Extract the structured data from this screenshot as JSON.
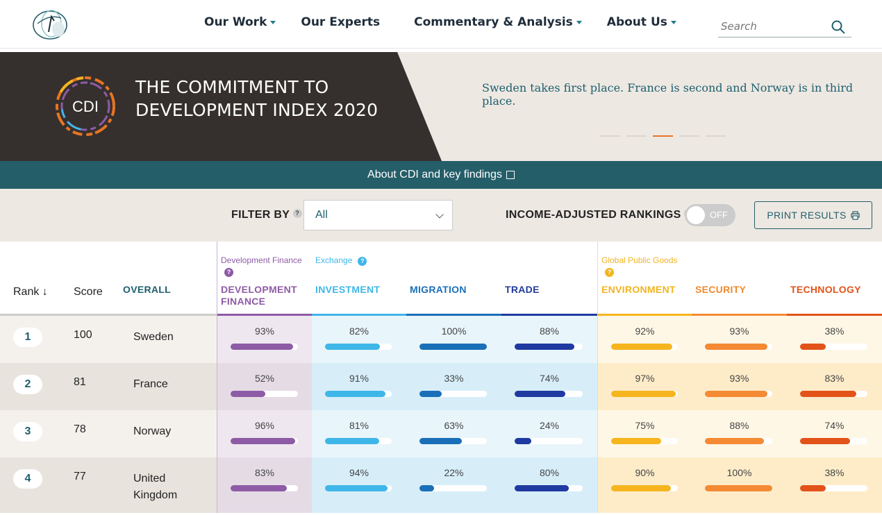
{
  "nav": {
    "items": [
      {
        "label": "Our Work",
        "dropdown": true
      },
      {
        "label": "Our Experts",
        "dropdown": false
      },
      {
        "label": "Commentary & Analysis",
        "dropdown": true
      },
      {
        "label": "About Us",
        "dropdown": true
      }
    ],
    "search_placeholder": "Search"
  },
  "banner": {
    "badge": "CDI",
    "title_line1": "THE COMMITMENT TO",
    "title_line2": "DEVELOPMENT INDEX 2020",
    "message": "Sweden takes first place. France is second and Norway is in third place.",
    "slide_count": 5,
    "active_slide": 3
  },
  "about_bar": {
    "label": "About CDI and key findings"
  },
  "filters": {
    "filter_label": "FILTER BY",
    "filter_value": "All",
    "income_label": "INCOME-ADJUSTED RANKINGS",
    "toggle_text": "OFF",
    "print_label": "PRINT RESULTS"
  },
  "table": {
    "rank_header": "Rank ↓",
    "score_header": "Score",
    "overall_header": "OVERALL",
    "groups": [
      {
        "label": "Development Finance",
        "color": "#8e5ba6"
      },
      {
        "label": "Exchange",
        "color": "#3fb6e8"
      },
      {
        "label": "Global Public Goods",
        "color": "#f3b420"
      }
    ],
    "columns": [
      {
        "name_line1": "DEVELOPMENT",
        "name_line2": "FINANCE",
        "color": "#8e5ba6",
        "bar": "#8e5ba6",
        "bg_even": "#efe7ef",
        "bg_odd": "#e5dbe5"
      },
      {
        "name_line1": "INVESTMENT",
        "name_line2": "",
        "color": "#3fb6e8",
        "bar": "#3fb6e8",
        "bg_even": "#e8f5fb",
        "bg_odd": "#d7eef9"
      },
      {
        "name_line1": "MIGRATION",
        "name_line2": "",
        "color": "#1a6fb8",
        "bar": "#1a6fb8",
        "bg_even": "#e8f5fb",
        "bg_odd": "#d7eef9"
      },
      {
        "name_line1": "TRADE",
        "name_line2": "",
        "color": "#213c9a",
        "bar": "#1f3aa0",
        "bg_even": "#e8f5fb",
        "bg_odd": "#d7eef9"
      },
      {
        "name_line1": "ENVIRONMENT",
        "name_line2": "",
        "color": "#f3b420",
        "bar": "#f6b51e",
        "bg_even": "#fff7e6",
        "bg_odd": "#feecc9"
      },
      {
        "name_line1": "SECURITY",
        "name_line2": "",
        "color": "#f08a2e",
        "bar": "#f48a33",
        "bg_even": "#fff7e6",
        "bg_odd": "#feecc9"
      },
      {
        "name_line1": "TECHNOLOGY",
        "name_line2": "",
        "color": "#e2531a",
        "bar": "#e2531a",
        "bg_even": "#fff7e6",
        "bg_odd": "#feecc9"
      }
    ],
    "rows": [
      {
        "rank": "1",
        "score": "100",
        "country": "Sweden",
        "values": [
          "93%",
          "82%",
          "100%",
          "88%",
          "92%",
          "93%",
          "38%"
        ],
        "fractions": [
          0.93,
          0.82,
          1.0,
          0.88,
          0.92,
          0.93,
          0.38
        ]
      },
      {
        "rank": "2",
        "score": "81",
        "country": "France",
        "values": [
          "52%",
          "91%",
          "33%",
          "74%",
          "97%",
          "93%",
          "83%"
        ],
        "fractions": [
          0.52,
          0.91,
          0.33,
          0.74,
          0.97,
          0.93,
          0.83
        ]
      },
      {
        "rank": "3",
        "score": "78",
        "country": "Norway",
        "values": [
          "96%",
          "81%",
          "63%",
          "24%",
          "75%",
          "88%",
          "74%"
        ],
        "fractions": [
          0.96,
          0.81,
          0.63,
          0.24,
          0.75,
          0.88,
          0.74
        ]
      },
      {
        "rank": "4",
        "score": "77",
        "country": "United Kingdom",
        "values": [
          "83%",
          "94%",
          "22%",
          "80%",
          "90%",
          "100%",
          "38%"
        ],
        "fractions": [
          0.83,
          0.94,
          0.22,
          0.8,
          0.9,
          1.0,
          0.38
        ]
      }
    ]
  }
}
